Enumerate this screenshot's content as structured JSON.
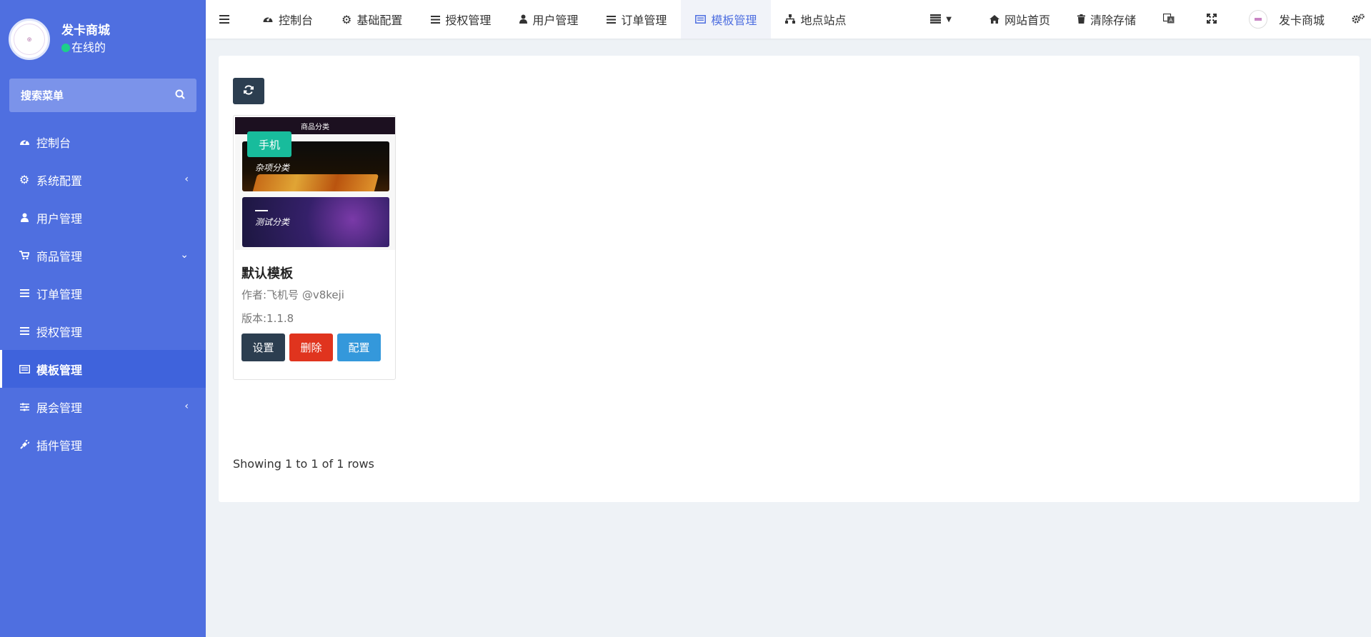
{
  "sidebar": {
    "user_name": "发卡商城",
    "user_status": "在线的",
    "search_placeholder": "搜索菜单",
    "items": [
      {
        "label": "控制台",
        "icon": "dashboard-icon"
      },
      {
        "label": "系统配置",
        "icon": "gear-icon",
        "arrow": "left"
      },
      {
        "label": "用户管理",
        "icon": "user-icon"
      },
      {
        "label": "商品管理",
        "icon": "cart-icon",
        "arrow": "down"
      },
      {
        "label": "订单管理",
        "icon": "list-icon"
      },
      {
        "label": "授权管理",
        "icon": "list-icon"
      },
      {
        "label": "模板管理",
        "icon": "template-icon",
        "active": true
      },
      {
        "label": "展会管理",
        "icon": "sliders-icon",
        "arrow": "left"
      },
      {
        "label": "插件管理",
        "icon": "plug-icon"
      }
    ]
  },
  "topbar": {
    "tabs": [
      {
        "label": "控制台"
      },
      {
        "label": "基础配置"
      },
      {
        "label": "授权管理"
      },
      {
        "label": "用户管理"
      },
      {
        "label": "订单管理"
      },
      {
        "label": "模板管理",
        "active": true
      },
      {
        "label": "地点站点"
      }
    ],
    "home_label": "网站首页",
    "clear_cache_label": "清除存储",
    "account_name": "发卡商城"
  },
  "template_card": {
    "image_header": "商品分类",
    "image_caption_1": "杂项分类",
    "image_caption_2": "测试分类",
    "badge": "手机",
    "title": "默认模板",
    "author": "作者:飞机号 @v8keji",
    "version": "版本:1.1.8",
    "buttons": {
      "settings": "设置",
      "delete": "删除",
      "config": "配置"
    }
  },
  "pagination_info": "Showing 1 to 1 of 1 rows",
  "colors": {
    "sidebar_bg": "#4f6fe0",
    "active_accent": "#4f6fe0",
    "badge": "#18bc9c",
    "btn_dark": "#2c3e50",
    "btn_danger": "#e0341e",
    "btn_info": "#3498db"
  }
}
